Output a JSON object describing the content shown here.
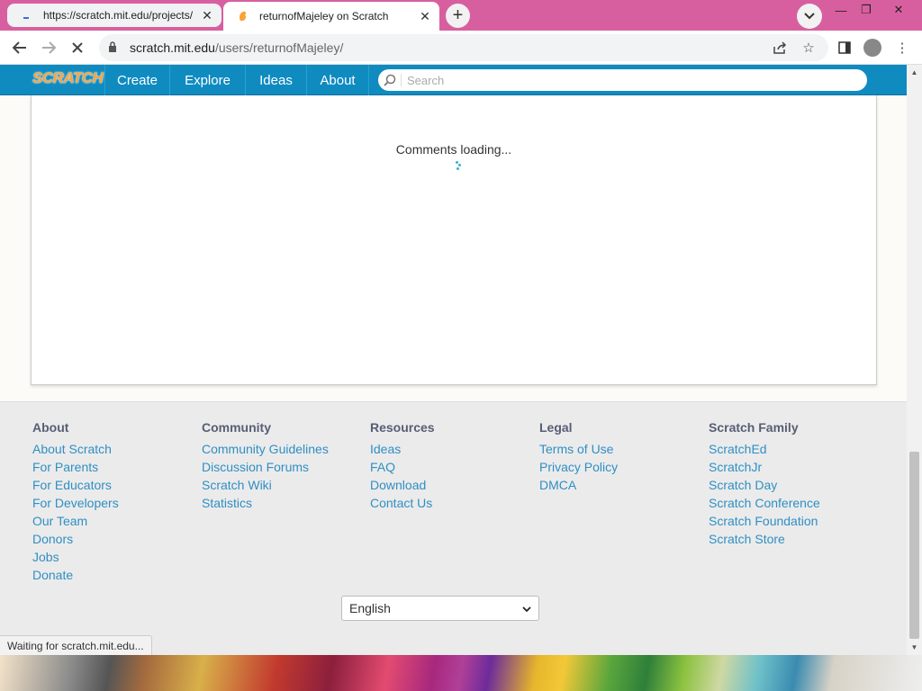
{
  "browser": {
    "tabs": [
      {
        "title": "https://scratch.mit.edu/projects/",
        "active": false
      },
      {
        "title": "returnofMajeley on Scratch",
        "active": true
      }
    ],
    "url_host": "scratch.mit.edu",
    "url_path": "/users/returnofMajeley/",
    "status_text": "Waiting for scratch.mit.edu..."
  },
  "scratch_nav": {
    "logo": "SCRATCH",
    "items": [
      "Create",
      "Explore",
      "Ideas",
      "About"
    ],
    "search_placeholder": "Search"
  },
  "comments": {
    "loading_text": "Comments loading..."
  },
  "footer": {
    "columns": [
      {
        "heading": "About",
        "links": [
          "About Scratch",
          "For Parents",
          "For Educators",
          "For Developers",
          "Our Team",
          "Donors",
          "Jobs",
          "Donate"
        ]
      },
      {
        "heading": "Community",
        "links": [
          "Community Guidelines",
          "Discussion Forums",
          "Scratch Wiki",
          "Statistics"
        ]
      },
      {
        "heading": "Resources",
        "links": [
          "Ideas",
          "FAQ",
          "Download",
          "Contact Us"
        ]
      },
      {
        "heading": "Legal",
        "links": [
          "Terms of Use",
          "Privacy Policy",
          "DMCA"
        ]
      },
      {
        "heading": "Scratch Family",
        "links": [
          "ScratchEd",
          "ScratchJr",
          "Scratch Day",
          "Scratch Conference",
          "Scratch Foundation",
          "Scratch Store"
        ]
      }
    ],
    "language": "English"
  },
  "colors": {
    "titlebar": "#d85f9f",
    "scratch_blue": "#0f8bc0",
    "link": "#2f8fc4"
  }
}
